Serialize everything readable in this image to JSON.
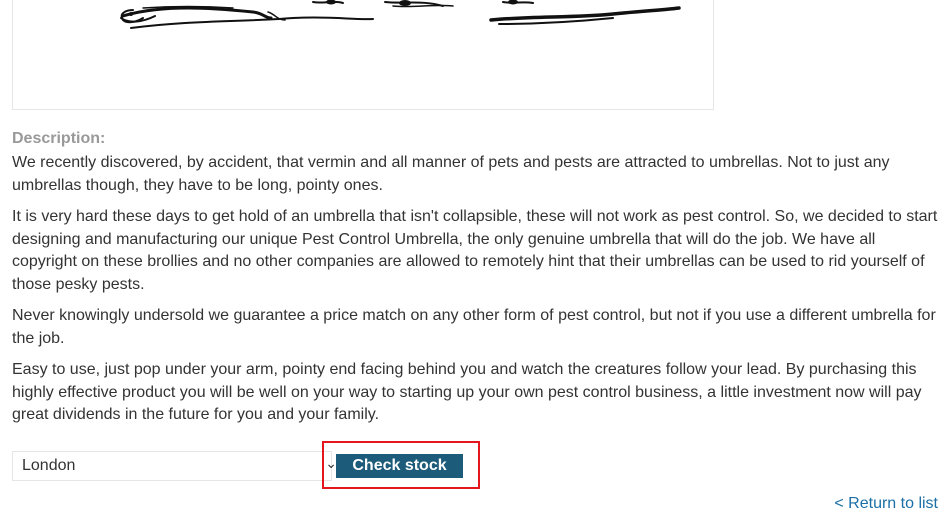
{
  "product": {
    "image_alt": "pest control umbrella illustration"
  },
  "description": {
    "label": "Description:",
    "paragraphs": [
      "We recently discovered, by accident, that vermin and all manner of pets and pests are attracted to umbrellas. Not to just any umbrellas though, they have to be long, pointy ones.",
      "It is very hard these days to get hold of an umbrella that isn't collapsible, these will not work as pest control. So, we decided to start designing and manufacturing our unique Pest Control Umbrella, the only genuine umbrella that will do the job. We have all copyright on these brollies and no other companies are allowed to remotely hint that their umbrellas can be used to rid yourself of those pesky pests.",
      "Never knowingly undersold we guarantee a price match on any other form of pest control, but not if you use a different umbrella for the job.",
      "Easy to use, just pop under your arm, pointy end facing behind you and watch the creatures follow your lead. By purchasing this highly effective product you will be well on your way to starting up your own pest control business, a little investment now will pay great dividends in the future for you and your family."
    ]
  },
  "stock": {
    "store_selected": "London",
    "check_button_label": "Check stock",
    "highlight_color": "#e4161e",
    "button_color": "#1c5c7a"
  },
  "nav": {
    "return_label": "< Return to list"
  }
}
